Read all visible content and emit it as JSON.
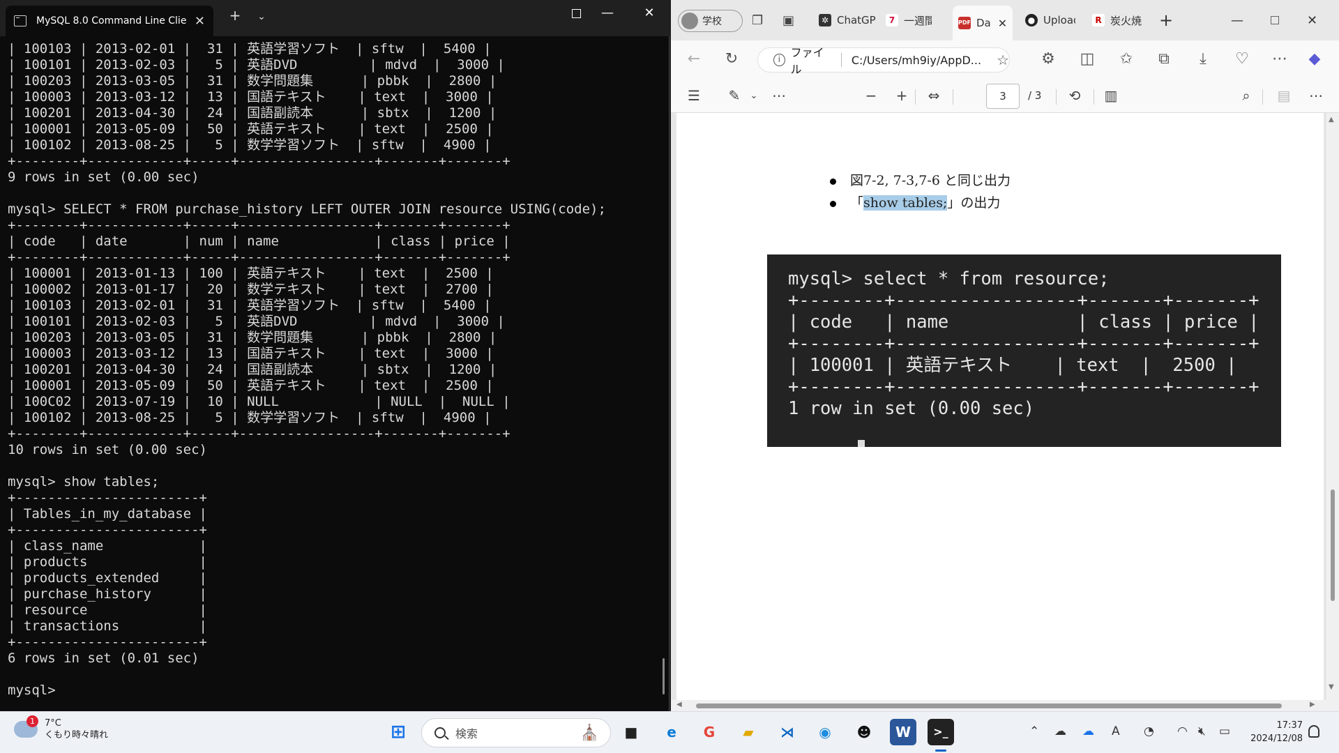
{
  "terminal": {
    "tab_title": "MySQL 8.0 Command Line Clie",
    "lines": [
      "| 100103 | 2013-02-01 |  31 | 英語学習ソフト  | sftw  |  5400 |",
      "| 100101 | 2013-02-03 |   5 | 英語DVD         | mdvd  |  3000 |",
      "| 100203 | 2013-03-05 |  31 | 数学問題集      | pbbk  |  2800 |",
      "| 100003 | 2013-03-12 |  13 | 国語テキスト    | text  |  3000 |",
      "| 100201 | 2013-04-30 |  24 | 国語副読本      | sbtx  |  1200 |",
      "| 100001 | 2013-05-09 |  50 | 英語テキスト    | text  |  2500 |",
      "| 100102 | 2013-08-25 |   5 | 数学学習ソフト  | sftw  |  4900 |",
      "+--------+------------+-----+-----------------+-------+-------+",
      "9 rows in set (0.00 sec)",
      "",
      "mysql> SELECT * FROM purchase_history LEFT OUTER JOIN resource USING(code);",
      "+--------+------------+-----+-----------------+-------+-------+",
      "| code   | date       | num | name            | class | price |",
      "+--------+------------+-----+-----------------+-------+-------+",
      "| 100001 | 2013-01-13 | 100 | 英語テキスト    | text  |  2500 |",
      "| 100002 | 2013-01-17 |  20 | 数学テキスト    | text  |  2700 |",
      "| 100103 | 2013-02-01 |  31 | 英語学習ソフト  | sftw  |  5400 |",
      "| 100101 | 2013-02-03 |   5 | 英語DVD         | mdvd  |  3000 |",
      "| 100203 | 2013-03-05 |  31 | 数学問題集      | pbbk  |  2800 |",
      "| 100003 | 2013-03-12 |  13 | 国語テキスト    | text  |  3000 |",
      "| 100201 | 2013-04-30 |  24 | 国語副読本      | sbtx  |  1200 |",
      "| 100001 | 2013-05-09 |  50 | 英語テキスト    | text  |  2500 |",
      "| 100C02 | 2013-07-19 |  10 | NULL            | NULL  |  NULL |",
      "| 100102 | 2013-08-25 |   5 | 数学学習ソフト  | sftw  |  4900 |",
      "+--------+------------+-----+-----------------+-------+-------+",
      "10 rows in set (0.00 sec)",
      "",
      "mysql> show tables;",
      "+-----------------------+",
      "| Tables_in_my_database |",
      "+-----------------------+",
      "| class_name            |",
      "| products              |",
      "| products_extended     |",
      "| purchase_history      |",
      "| resource              |",
      "| transactions          |",
      "+-----------------------+",
      "6 rows in set (0.01 sec)",
      "",
      "mysql>"
    ]
  },
  "browser": {
    "profile_label": "学校",
    "tabs": [
      {
        "label": "ChatGP",
        "icon": "chatgpt-icon"
      },
      {
        "label": "一週間で",
        "icon": "seven-icon"
      },
      {
        "label": "Da",
        "icon": "pdf-icon"
      },
      {
        "label": "Upload",
        "icon": "github-icon"
      },
      {
        "label": "炭火焼",
        "icon": "r-icon"
      }
    ],
    "address_scheme": "ファイル",
    "address_url": "C:/Users/mh9iy/AppD...",
    "pdf_page": "3",
    "pdf_total": "/ 3",
    "bullets": [
      {
        "text": "図7-2, 7-3,7-6 と同じ出力"
      },
      {
        "pre": "「",
        "highlight": "show tables;",
        "post": "」の出力"
      }
    ],
    "screenshot_lines": [
      "mysql> select * from resource;",
      "+--------+-----------------+-------+-------+",
      "| code   | name            | class | price |",
      "+--------+-----------------+-------+-------+",
      "| 100001 | 英語テキスト    | text  |  2500 |",
      "+--------+-----------------+-------+-------+",
      "1 row in set (0.00 sec)"
    ]
  },
  "taskbar": {
    "weather_temp": "7°C",
    "weather_desc": "くもり時々晴れ",
    "weather_badge": "1",
    "search_placeholder": "検索",
    "time": "17:37",
    "date": "2024/12/08"
  }
}
